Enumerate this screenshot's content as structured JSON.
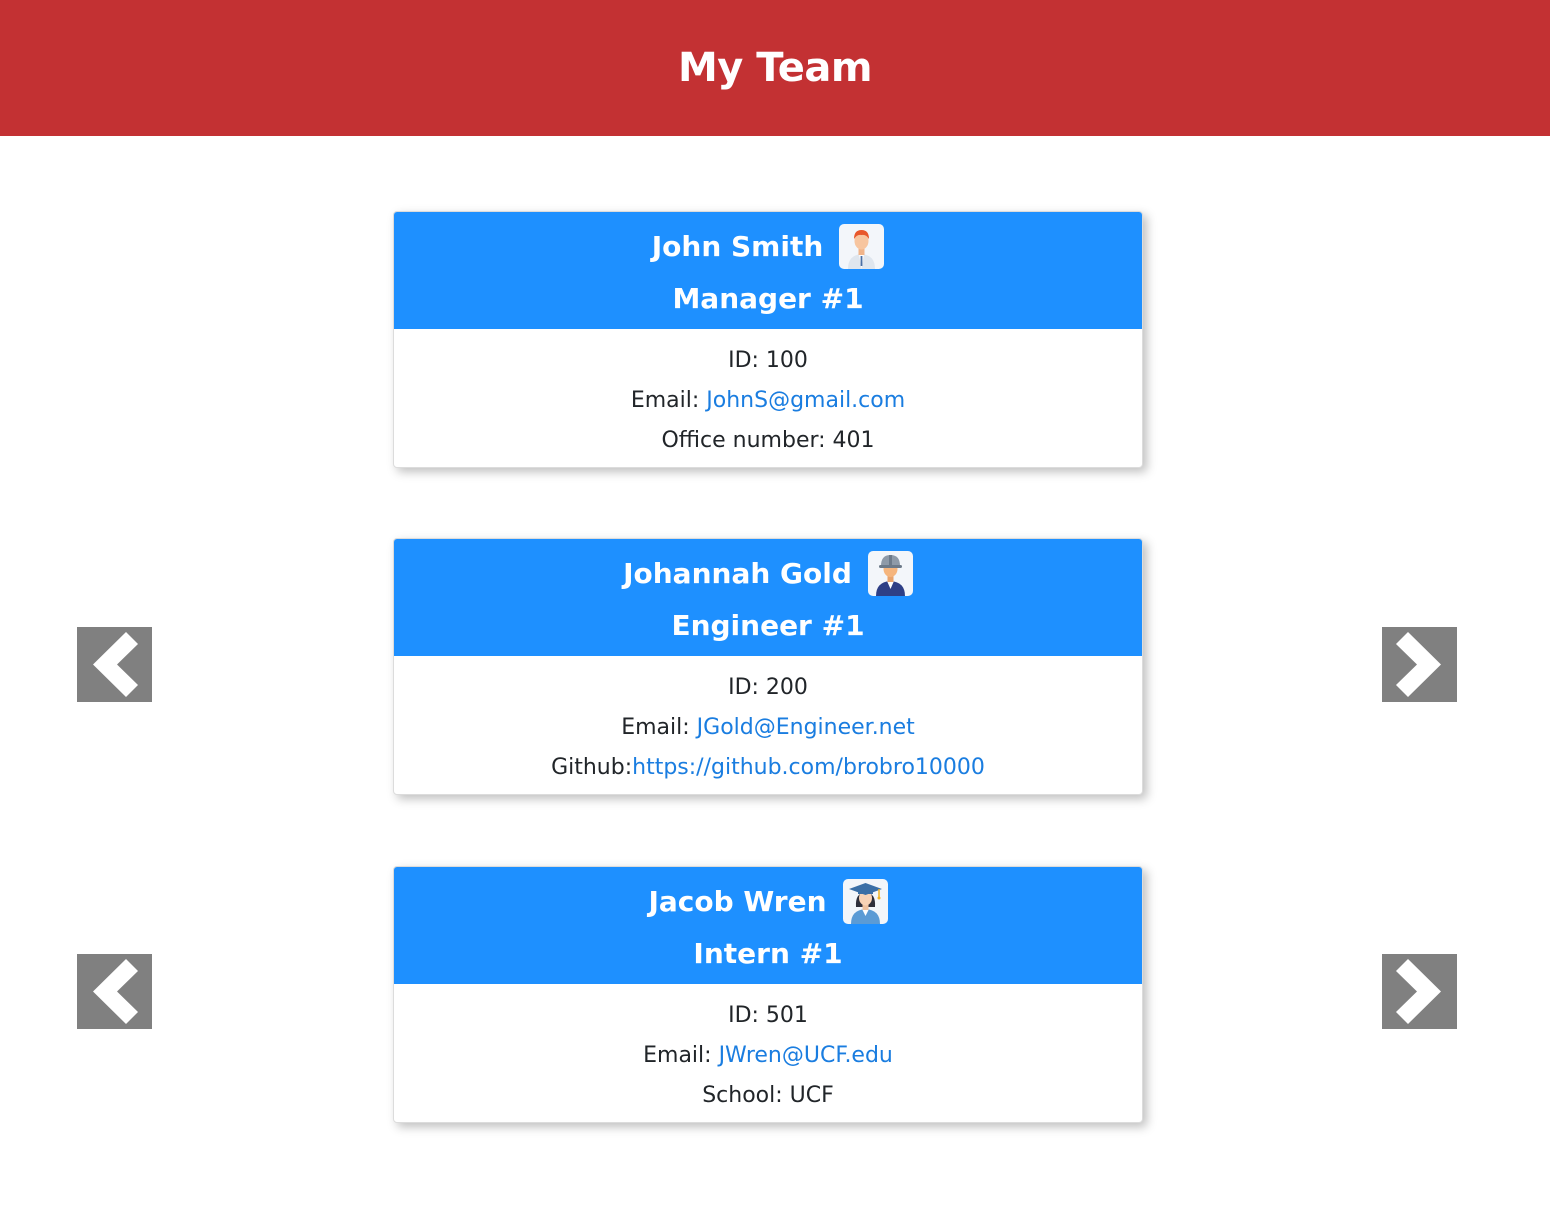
{
  "page": {
    "title": "My Team"
  },
  "colors": {
    "header_bg": "#c33133",
    "card_header_bg": "#1e90ff",
    "link": "#1a7de0",
    "arrow_bg": "#808080"
  },
  "cards": [
    {
      "name": "John Smith",
      "role": "Manager #1",
      "icon": "manager-avatar-icon",
      "id_text": "ID: 100",
      "email_label": "Email: ",
      "email": "JohnS@gmail.com",
      "extra_label": "Office number: 401",
      "extra_value": ""
    },
    {
      "name": "Johannah Gold",
      "role": "Engineer #1",
      "icon": "engineer-avatar-icon",
      "id_text": "ID: 200",
      "email_label": "Email: ",
      "email": "JGold@Engineer.net",
      "extra_label": "Github:",
      "extra_value": "https://github.com/brobro10000"
    },
    {
      "name": "Jacob Wren",
      "role": "Intern #1",
      "icon": "intern-avatar-icon",
      "id_text": "ID: 501",
      "email_label": "Email: ",
      "email": "JWren@UCF.edu",
      "extra_label": "School: UCF",
      "extra_value": ""
    }
  ],
  "carousel": {
    "prev_icon": "chevron-left-icon",
    "next_icon": "chevron-right-icon"
  }
}
